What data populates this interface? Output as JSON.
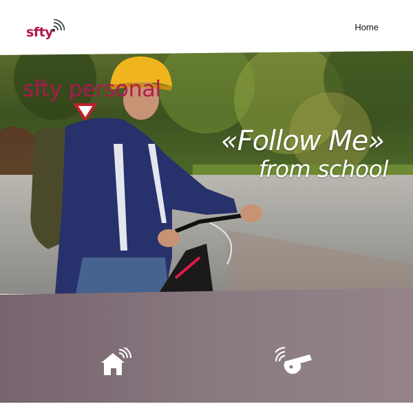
{
  "header": {
    "logo_text": "sfty",
    "nav": {
      "home_label": "Home"
    }
  },
  "hero": {
    "brand_title": "sfty personal",
    "tagline_line1": "«Follow Me»",
    "tagline_line2": "from school"
  },
  "actions": {
    "home_icon": "home-signal-icon",
    "whistle_icon": "whistle-signal-icon"
  },
  "colors": {
    "brand": "#b0174f",
    "panel": "#7f6f77"
  }
}
